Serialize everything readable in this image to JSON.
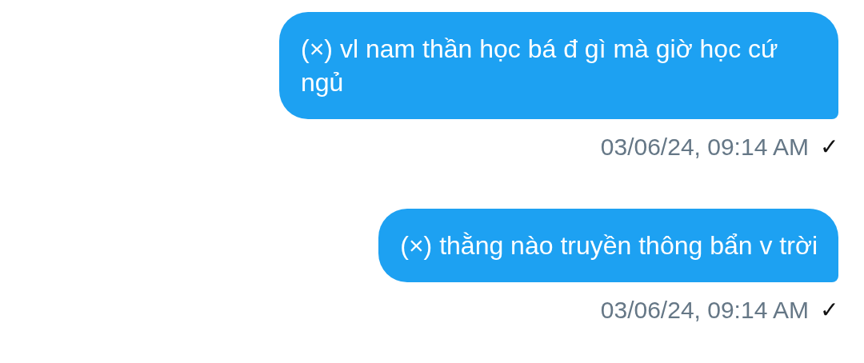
{
  "messages": [
    {
      "text": "(×) vl nam thần học bá đ gì mà giờ học cứ ngủ",
      "timestamp": "03/06/24, 09:14 AM",
      "status_mark": "✓"
    },
    {
      "text": "(×) thằng nào truyền thông bẩn v trời",
      "timestamp": "03/06/24, 09:14 AM",
      "status_mark": "✓"
    }
  ]
}
